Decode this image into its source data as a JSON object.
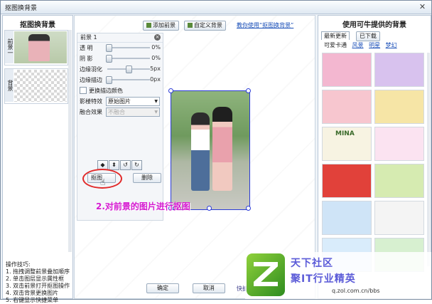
{
  "window": {
    "title": "抠图换背景",
    "close_symbol": "✕"
  },
  "left_panel": {
    "title": "抠图换背景",
    "layers": [
      {
        "tag": "前景一"
      },
      {
        "tag": "背景"
      }
    ],
    "tips": {
      "heading": "操作技巧:",
      "items": [
        "1. 拖拽调整前景叠加顺序",
        "2. 单击图层显示属性框",
        "3. 双击前景打开抠图操作",
        "4. 双击背景更换图片",
        "5. 右键显示快捷菜单"
      ]
    }
  },
  "top_tabs": {
    "add_foreground": "添加前景",
    "custom_background": "自定义背景",
    "howto_link": "教你使用“抠图换背景”"
  },
  "properties": {
    "header": "前景 1",
    "sliders": [
      {
        "label": "透 明",
        "value": "0%",
        "level": 0.0
      },
      {
        "label": "阴 影",
        "value": "0%",
        "level": 0.0
      },
      {
        "label": "边缘羽化",
        "value": "5px",
        "level": 0.5
      },
      {
        "label": "边缘描边",
        "value": "0px",
        "level": 0.0
      }
    ],
    "edge_color_label": "更换描边颜色",
    "effect_label": "影楼特效",
    "effect_value": "原始图片",
    "blend_label": "融合效果",
    "blend_value": "不融合",
    "cut_button": "抠图",
    "delete_button": "删除"
  },
  "canvas": {
    "instruction": "2.对前景的图片进行抠图"
  },
  "bottom": {
    "ok": "确定",
    "cancel": "取消",
    "shortcut": "快捷方式"
  },
  "right_panel": {
    "title": "使用可牛提供的背景",
    "tab_latest": "最新更新",
    "tab_downloaded": "已下载",
    "categories": [
      "可爱卡通",
      "风景",
      "明星",
      "梦幻"
    ],
    "thumbnails": [
      {
        "name": "pink-flowers",
        "color": "#f3b7d0",
        "text": ""
      },
      {
        "name": "purple-dreamy",
        "color": "#d8c2ee",
        "text": ""
      },
      {
        "name": "pink-dots",
        "color": "#f7c6cf",
        "text": ""
      },
      {
        "name": "yellow-pattern",
        "color": "#f6e5a6",
        "text": ""
      },
      {
        "name": "mina-card",
        "color": "#f7f3e2",
        "text": "MINA"
      },
      {
        "name": "flower-garden",
        "color": "#fbe3f1",
        "text": ""
      },
      {
        "name": "red-frame",
        "color": "#e1413a",
        "text": ""
      },
      {
        "name": "green-light",
        "color": "#d6ebb1",
        "text": ""
      },
      {
        "name": "blue-frame",
        "color": "#cfe4f7",
        "text": ""
      },
      {
        "name": "white-sparkle",
        "color": "#f4f4f4",
        "text": ""
      },
      {
        "name": "cartoon-blue",
        "color": "#d9ecfb",
        "text": ""
      },
      {
        "name": "green-bottom",
        "color": "#d7f0d0",
        "text": ""
      }
    ]
  },
  "watermark": {
    "line1": "天下社区",
    "line2": "聚IT行业精英",
    "url": "q.zol.com.cn/bbs"
  },
  "colors": {
    "accent_blue": "#1a4fb8",
    "instruction_magenta": "#d51ad1",
    "selection_blue": "#2b3bd6",
    "ring_red": "#e12a2a"
  }
}
